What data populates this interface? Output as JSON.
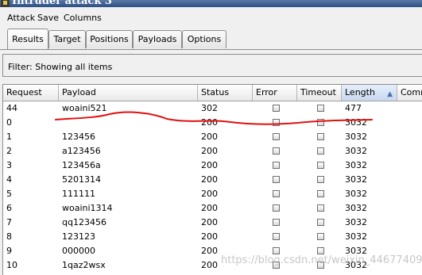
{
  "window": {
    "title": "Intruder attack 3"
  },
  "menu": [
    "Attack",
    "Save",
    "Columns"
  ],
  "tabs": [
    "Results",
    "Target",
    "Positions",
    "Payloads",
    "Options"
  ],
  "active_tab": "Results",
  "filter": {
    "text": "Filter: Showing all items"
  },
  "table": {
    "columns": [
      "Request",
      "Payload",
      "Status",
      "Error",
      "Timeout",
      "Length",
      "Comm"
    ],
    "sorted_column": "Length",
    "rows": [
      {
        "request": "44",
        "payload": "woaini521",
        "status": "302",
        "error": false,
        "timeout": false,
        "length": "477"
      },
      {
        "request": "0",
        "payload": "",
        "status": "200",
        "error": false,
        "timeout": false,
        "length": "3032"
      },
      {
        "request": "1",
        "payload": "123456",
        "status": "200",
        "error": false,
        "timeout": false,
        "length": "3032"
      },
      {
        "request": "2",
        "payload": "a123456",
        "status": "200",
        "error": false,
        "timeout": false,
        "length": "3032"
      },
      {
        "request": "3",
        "payload": "123456a",
        "status": "200",
        "error": false,
        "timeout": false,
        "length": "3032"
      },
      {
        "request": "4",
        "payload": "5201314",
        "status": "200",
        "error": false,
        "timeout": false,
        "length": "3032"
      },
      {
        "request": "5",
        "payload": "111111",
        "status": "200",
        "error": false,
        "timeout": false,
        "length": "3032"
      },
      {
        "request": "6",
        "payload": "woaini1314",
        "status": "200",
        "error": false,
        "timeout": false,
        "length": "3032"
      },
      {
        "request": "7",
        "payload": "qq123456",
        "status": "200",
        "error": false,
        "timeout": false,
        "length": "3032"
      },
      {
        "request": "8",
        "payload": "123123",
        "status": "200",
        "error": false,
        "timeout": false,
        "length": "3032"
      },
      {
        "request": "9",
        "payload": "000000",
        "status": "200",
        "error": false,
        "timeout": false,
        "length": "3032"
      },
      {
        "request": "10",
        "payload": "1qaz2wsx",
        "status": "200",
        "error": false,
        "timeout": false,
        "length": "3032"
      }
    ]
  },
  "watermark": "https://blog.csdn.net/weixin_44677409",
  "colors": {
    "annotation": "#e01010",
    "sorted_header": "#c9d8f0"
  }
}
